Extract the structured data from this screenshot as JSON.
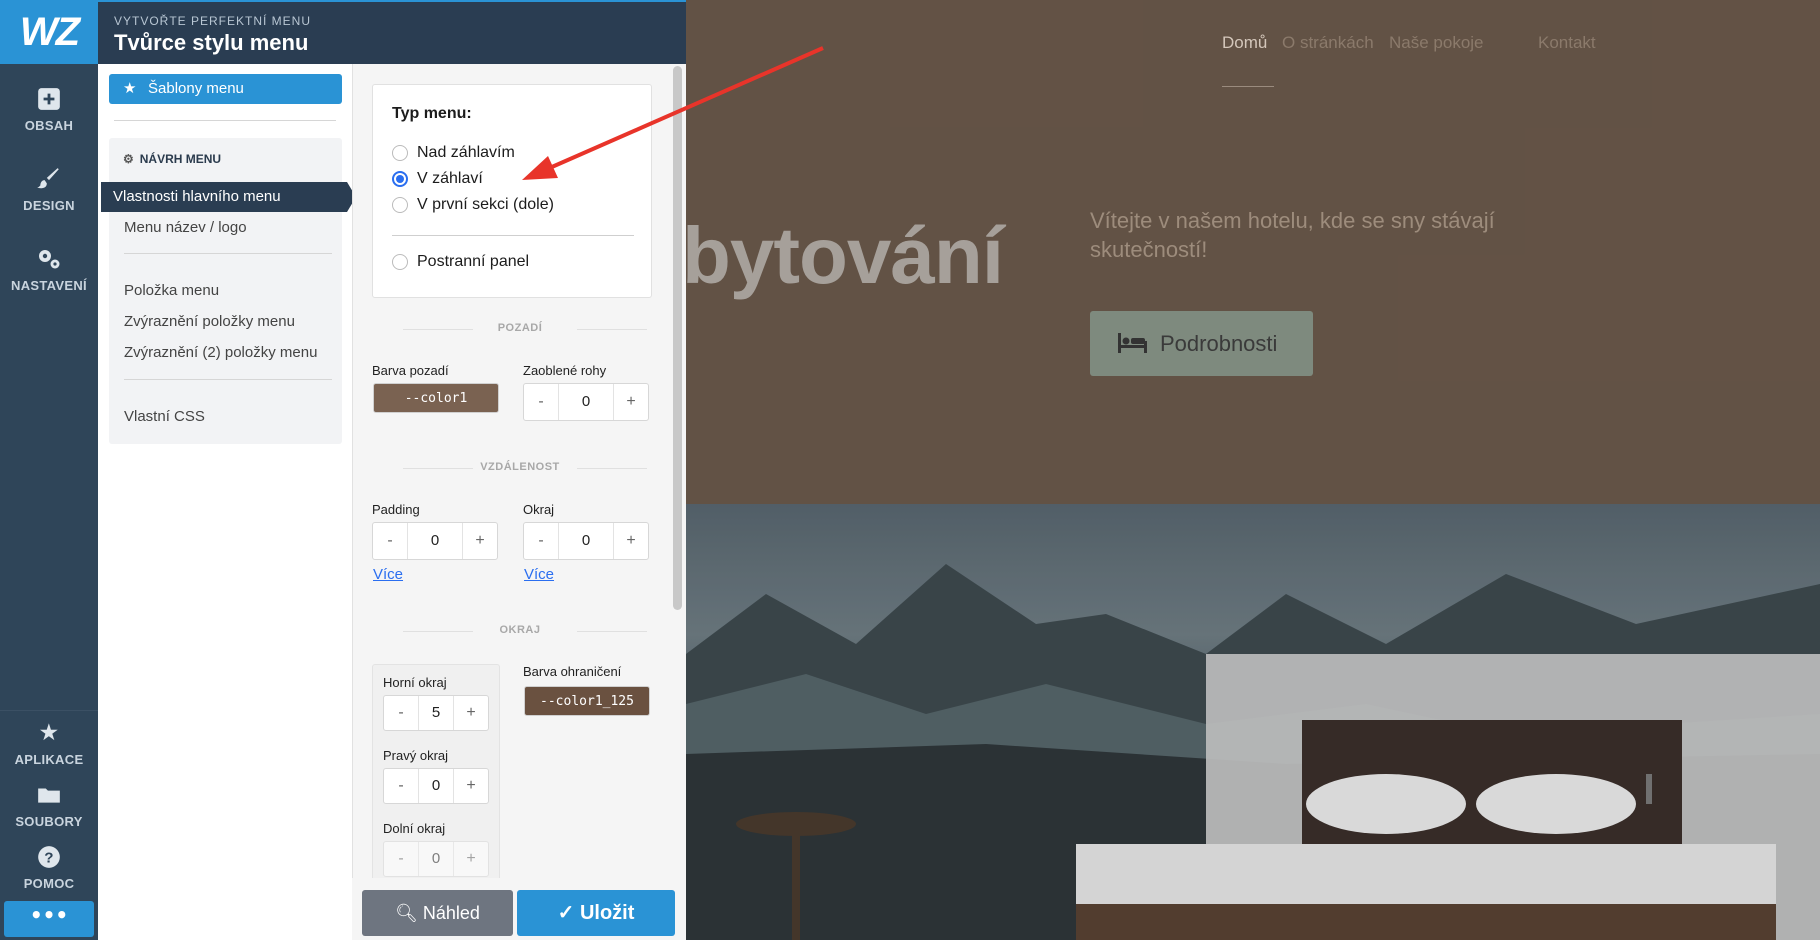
{
  "app": {
    "logo": "WZ",
    "subtitle": "VYTVOŘTE PERFEKTNÍ MENU",
    "title": "Tvůrce stylu menu"
  },
  "rail": {
    "items": [
      {
        "label": "OBSAH",
        "icon": "plus-square-icon"
      },
      {
        "label": "DESIGN",
        "icon": "brush-icon"
      },
      {
        "label": "NASTAVENÍ",
        "icon": "gears-icon"
      },
      {
        "label": "APLIKACE",
        "icon": "star-icon"
      },
      {
        "label": "SOUBORY",
        "icon": "folder-icon"
      },
      {
        "label": "POMOC",
        "icon": "help-icon"
      }
    ],
    "more": "•••"
  },
  "nav": {
    "templates_label": "Šablony menu",
    "section_head": "NÁVRH MENU",
    "links": {
      "main_props": "Vlastnosti hlavního menu",
      "name_logo": "Menu název / logo",
      "item": "Položka menu",
      "highlight": "Zvýraznění položky menu",
      "highlight2": "Zvýraznění (2) položky menu",
      "css": "Vlastní CSS"
    }
  },
  "settings": {
    "menu_type": {
      "title": "Typ menu:",
      "options": [
        "Nad záhlavím",
        "V záhlaví",
        "V první sekci (dole)",
        "Postranní panel"
      ],
      "selected": "V záhlaví"
    },
    "background": {
      "section": "POZADÍ",
      "color_label": "Barva pozadí",
      "color_value": "--color1",
      "color_hex": "#7a6251",
      "radius_label": "Zaoblené rohy",
      "radius_value": "0"
    },
    "spacing": {
      "section": "VZDÁLENOST",
      "padding_label": "Padding",
      "padding_value": "0",
      "margin_label": "Okraj",
      "margin_value": "0",
      "more": "Více"
    },
    "border": {
      "section": "OKRAJ",
      "top_label": "Horní okraj",
      "top_value": "5",
      "right_label": "Pravý okraj",
      "right_value": "0",
      "bottom_label": "Dolní okraj",
      "bottom_value": "0",
      "color_label": "Barva ohraničení",
      "color_value": "--color1_125",
      "color_hex": "#6a5140"
    },
    "stepper": {
      "minus": "-",
      "plus": "+"
    }
  },
  "actions": {
    "preview": "Náhled",
    "save": "Uložit"
  },
  "preview": {
    "nav": [
      "Domů",
      "O stránkách",
      "Naše pokoje",
      "Kontakt"
    ],
    "headline_fragment": "bytování",
    "welcome": "Vítejte v našem hotelu, kde se sny stávají skutečností!",
    "button": "Podrobnosti"
  },
  "colors": {
    "accent": "#2a93d5",
    "rail": "#2f4559",
    "header": "#2a3d52",
    "arrow": "#e8342a"
  }
}
